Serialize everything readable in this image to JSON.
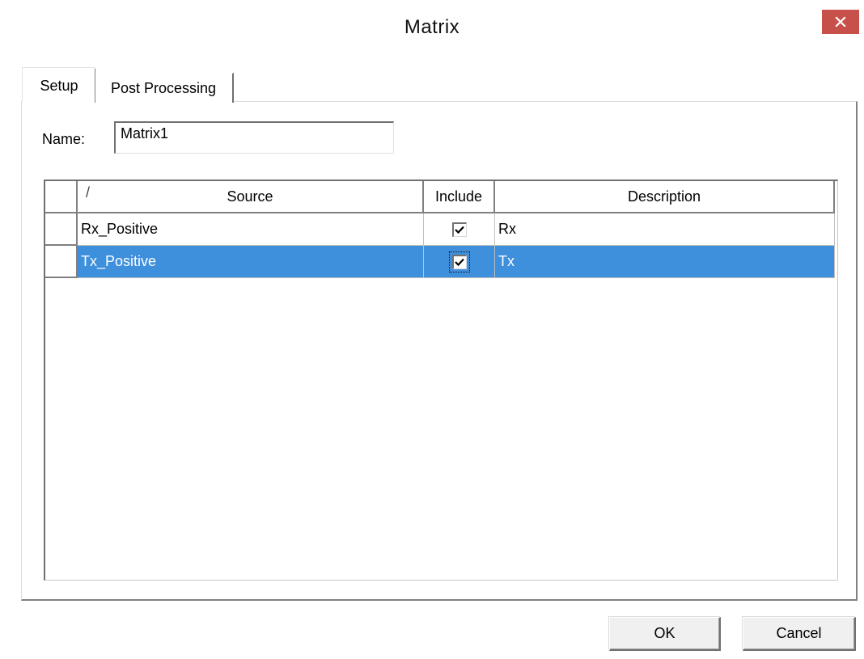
{
  "window": {
    "title": "Matrix",
    "close_icon": "close-icon",
    "close_color": "#c7504a"
  },
  "tabs": [
    {
      "label": "Setup",
      "active": true
    },
    {
      "label": "Post Processing",
      "active": false
    }
  ],
  "name_field": {
    "label": "Name:",
    "value": "Matrix1"
  },
  "grid": {
    "columns": {
      "sort_marker": "/",
      "source": "Source",
      "include": "Include",
      "description": "Description"
    },
    "rows": [
      {
        "source": "Rx_Positive",
        "include": true,
        "description": "Rx",
        "selected": false
      },
      {
        "source": "Tx_Positive",
        "include": true,
        "description": "Tx",
        "selected": true
      }
    ],
    "selection_color": "#3e8fdc"
  },
  "buttons": {
    "ok": "OK",
    "cancel": "Cancel"
  }
}
